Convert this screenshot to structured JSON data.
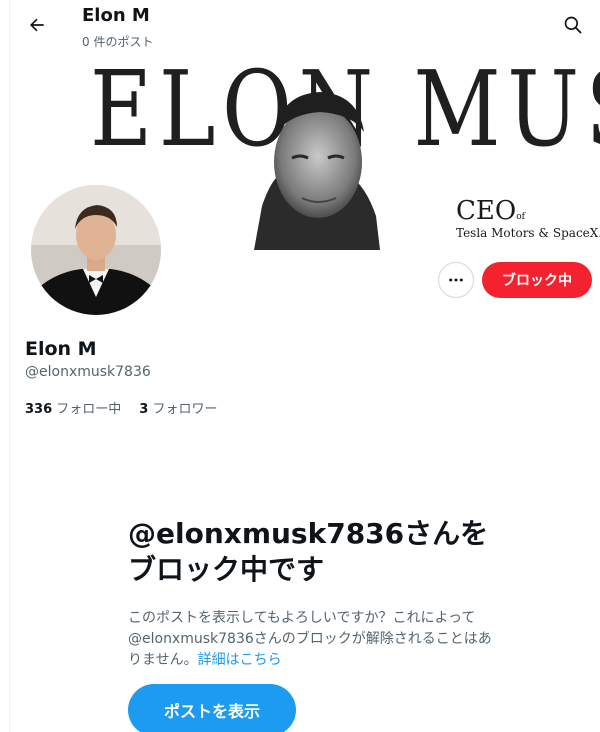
{
  "header": {
    "title": "Elon M",
    "subtitle": "0 件のポスト",
    "back_icon": "arrow-left-icon",
    "search_icon": "search-icon"
  },
  "banner": {
    "headline": "ELON MUSK",
    "ceo_text": "CEO",
    "ceo_of": "of",
    "company": "Tesla Motors & SpaceX."
  },
  "profile": {
    "display_name": "Elon M",
    "handle": "@elonxmusk7836",
    "following_count": "336",
    "following_label": "フォロー中",
    "followers_count": "3",
    "followers_label": "フォロワー"
  },
  "actions": {
    "more_icon": "ellipsis-icon",
    "block_label": "ブロック中"
  },
  "blocked": {
    "title": "@elonxmusk7836さんをブロック中です",
    "description": "このポストを表示してもよろしいですか？これによって@elonxmusk7836さんのブロックが解除されることはありません。",
    "link_text": "詳細はこちら",
    "button_label": "ポストを表示"
  },
  "colors": {
    "accent": "#1d9bf0",
    "danger": "#f4212e",
    "text_primary": "#0f1419",
    "text_secondary": "#536471"
  }
}
